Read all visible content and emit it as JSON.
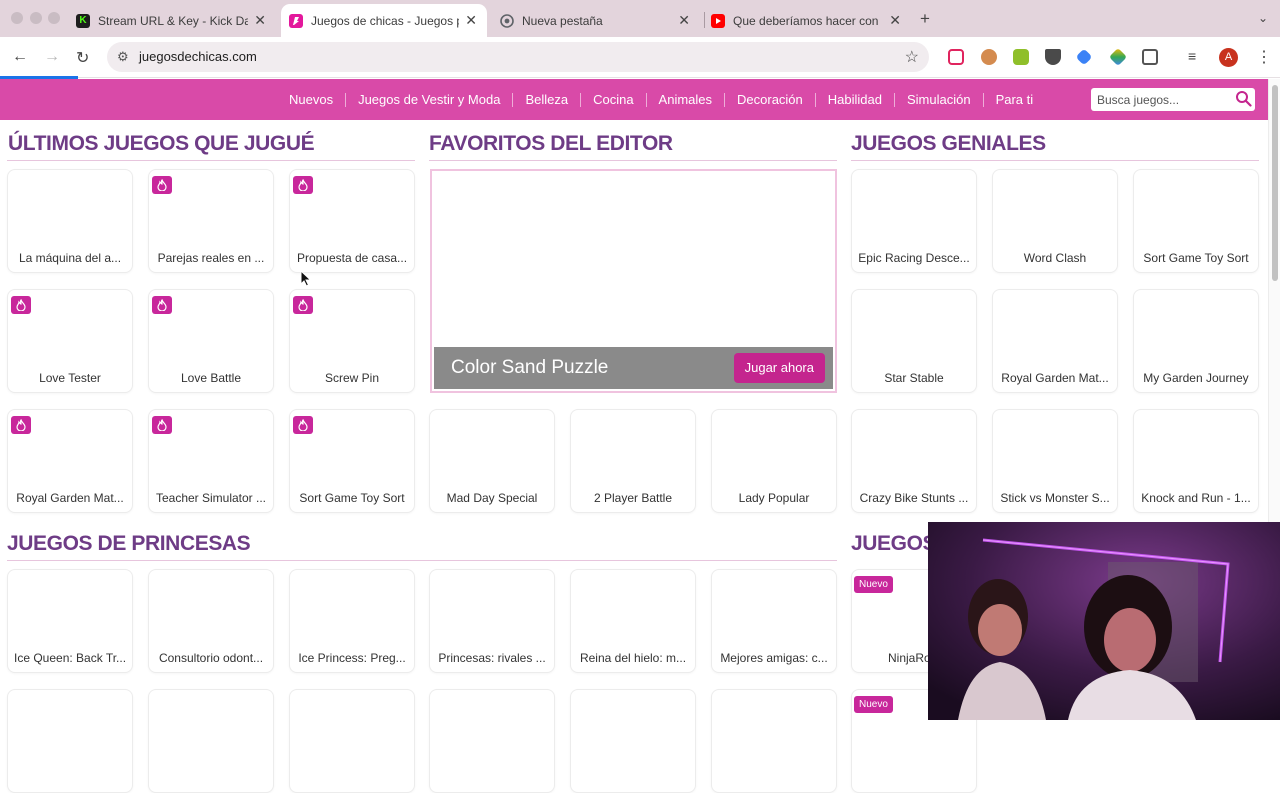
{
  "browser": {
    "tabs": [
      {
        "title": "Stream URL & Key - Kick Dashboard",
        "favicon": "K",
        "favicon_color": "#53fc18"
      },
      {
        "title": "Juegos de chicas - Juegos para chicas",
        "favicon": "",
        "favicon_color": "#e3189c"
      },
      {
        "title": "Nueva pestaña",
        "favicon": "",
        "favicon_color": "#5f6368"
      },
      {
        "title": "Que deberíamos hacer con el",
        "favicon": "",
        "favicon_color": "#ff0000"
      }
    ],
    "url": "juegosdechicas.com",
    "profile_initial": "A",
    "icons": [
      "back-icon",
      "forward-icon",
      "reload-icon",
      "tune-icon",
      "star-icon",
      "extensions-icon",
      "menu-icon"
    ]
  },
  "site": {
    "accent_color": "#d94aa8",
    "nav": [
      "Nuevos",
      "Juegos de Vestir y Moda",
      "Belleza",
      "Cocina",
      "Animales",
      "Decoración",
      "Habilidad",
      "Simulación",
      "Para ti"
    ],
    "search_placeholder": "Busca juegos..."
  },
  "sections": {
    "recent": {
      "title": "ÚLTIMOS JUEGOS QUE JUGUÉ",
      "games": [
        "La máquina del a...",
        "Parejas reales en ...",
        "Propuesta de casa...",
        "Love Tester",
        "Love Battle",
        "Screw Pin",
        "Royal Garden Mat...",
        "Teacher Simulator ...",
        "Sort Game Toy Sort"
      ]
    },
    "editor": {
      "title": "FAVORITOS DEL EDITOR",
      "featured_name": "Color Sand Puzzle",
      "play_label": "Jugar ahora",
      "games": [
        "Mad Day Special",
        "2 Player Battle",
        "Lady Popular"
      ]
    },
    "cool": {
      "title": "JUEGOS GENIALES",
      "games": [
        "Epic Racing Desce...",
        "Word Clash",
        "Sort Game Toy Sort",
        "Star Stable",
        "Royal Garden Mat...",
        "My Garden Journey",
        "Crazy Bike Stunts ...",
        "Stick vs Monster S...",
        "Knock and Run - 1..."
      ]
    },
    "princess": {
      "title": "JUEGOS DE PRINCESAS",
      "games": [
        "Ice Queen: Back Tr...",
        "Consultorio odont...",
        "Ice Princess: Preg...",
        "Princesas: rivales ...",
        "Reina del hielo: m...",
        "Mejores amigas: c..."
      ]
    },
    "partial": {
      "title": "JUEGOS",
      "badge": "Nuevo",
      "games": [
        "NinjaRo"
      ]
    }
  }
}
